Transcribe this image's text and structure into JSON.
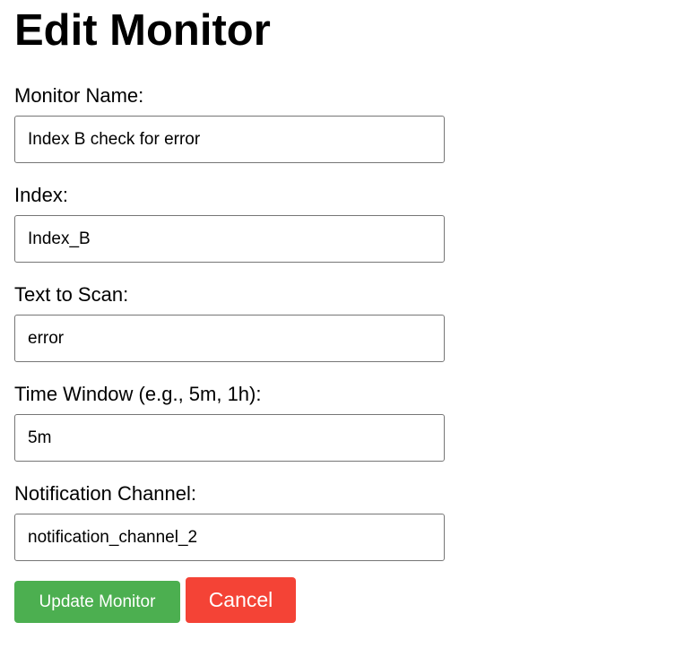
{
  "page": {
    "title": "Edit Monitor"
  },
  "form": {
    "monitor_name": {
      "label": "Monitor Name:",
      "value": "Index B check for error"
    },
    "index": {
      "label": "Index:",
      "value": "Index_B"
    },
    "text_to_scan": {
      "label": "Text to Scan:",
      "value": "error"
    },
    "time_window": {
      "label": "Time Window (e.g., 5m, 1h):",
      "value": "5m"
    },
    "notification_channel": {
      "label": "Notification Channel:",
      "value": "notification_channel_2"
    }
  },
  "actions": {
    "update_label": "Update Monitor",
    "cancel_label": "Cancel"
  },
  "colors": {
    "update_button": "#4caf50",
    "cancel_button": "#f44336",
    "input_border": "#767676"
  }
}
